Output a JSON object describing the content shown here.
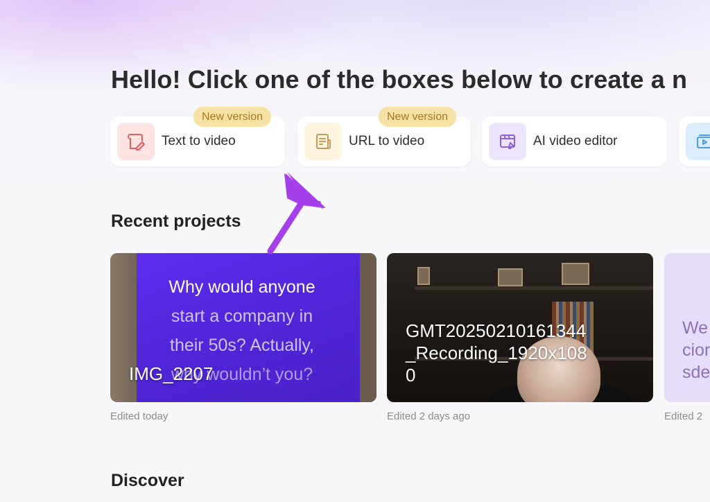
{
  "greeting": "Hello! Click one of the boxes below to create a n",
  "tools": [
    {
      "label": "Text to video",
      "badge": "New version",
      "icon": "text-to-video-icon",
      "accent": "#e25c5c",
      "tint": "#fde3e1"
    },
    {
      "label": "URL to video",
      "badge": "New version",
      "icon": "url-doc-icon",
      "accent": "#d0a25a",
      "tint": "#fff4df"
    },
    {
      "label": "AI video editor",
      "badge": "",
      "icon": "video-edit-icon",
      "accent": "#8a60e0",
      "tint": "#ece3ff"
    },
    {
      "label": "",
      "badge": "",
      "icon": "video-stack-icon",
      "accent": "#4c9be6",
      "tint": "#dcecff"
    }
  ],
  "recent": {
    "title": "Recent projects",
    "projects": [
      {
        "name": "IMG_2207",
        "meta": "Edited today",
        "caption": [
          "Why would anyone",
          "start a company in",
          "their 50s? Actually,",
          "why wouldn’t you?"
        ]
      },
      {
        "name_lines": [
          "GMT20250210161344",
          "_Recording_1920x108",
          "0"
        ],
        "meta": "Edited 2 days ago"
      },
      {
        "text_lines": [
          "We",
          "cior",
          "sde"
        ],
        "meta": "Edited 2"
      }
    ]
  },
  "discover": {
    "title": "Discover"
  },
  "colors": {
    "arrow": "#a53fea",
    "badge_bg": "#f7e2a6",
    "badge_text": "#a8771f",
    "caption_panel": "#5a2bee"
  }
}
